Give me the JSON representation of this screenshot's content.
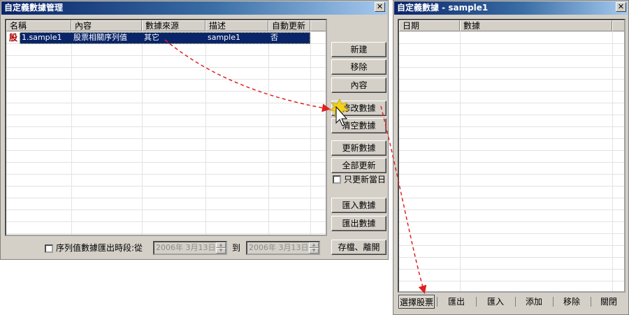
{
  "main_window": {
    "title": "自定義數據管理",
    "close_glyph": "✕",
    "columns": [
      "名稱",
      "內容",
      "數據來源",
      "描述",
      "自動更新",
      ""
    ],
    "rows": [
      {
        "icon_text": "股",
        "name": "1.sample1",
        "content": "股票相關序列值",
        "source": "其它",
        "description": "sample1",
        "auto_update": "否"
      }
    ],
    "buttons": {
      "new": "新建",
      "remove": "移除",
      "content": "內容",
      "modify": "修改數據",
      "clear": "清空數據",
      "update": "更新數據",
      "update_all": "全部更新",
      "only_today": "只更新當日",
      "import": "匯入數據",
      "export": "匯出數據",
      "save_exit": "存檔、離開"
    },
    "export_period": {
      "label": "序列值數據匯出時段:從",
      "from_date": "2006年  3月13日",
      "to_label": "到",
      "to_date": "2006年  3月13日"
    }
  },
  "data_window": {
    "title": "自定義數據 - sample1",
    "close_glyph": "✕",
    "columns": [
      "日期",
      "數據"
    ],
    "toolbar": {
      "select_stock": "選擇股票",
      "export": "匯出",
      "import": "匯入",
      "add": "添加",
      "remove": "移除",
      "close": "關閉"
    }
  },
  "colors": {
    "window_bg": "#d4d0c8",
    "title_start": "#0a246a",
    "selection": "#0a246a",
    "arrow": "#e02020"
  },
  "icons": [
    "close-icon",
    "stock-icon",
    "checkbox",
    "spin-arrows-icon",
    "cursor-icon",
    "starburst-icon"
  ]
}
